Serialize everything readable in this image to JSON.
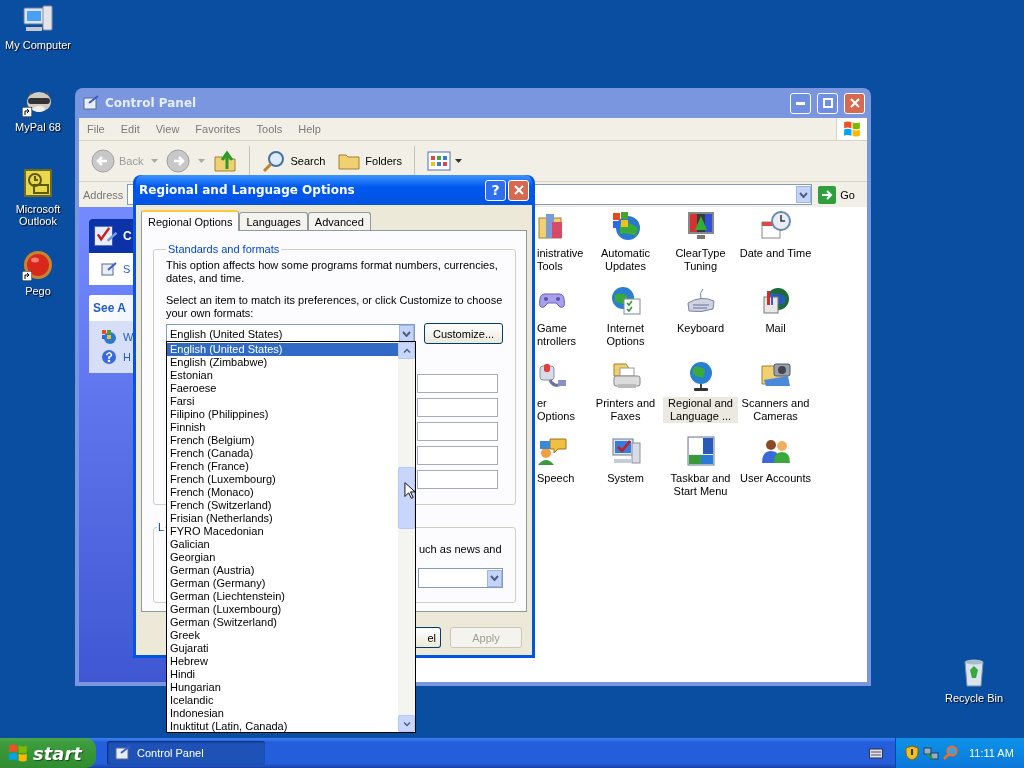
{
  "desktop_icons": [
    {
      "label": "My Computer",
      "kind": "computer",
      "shortcut": false
    },
    {
      "label": "MyPal 68",
      "kind": "raccoon",
      "shortcut": true
    },
    {
      "label": "Microsoft Outlook",
      "kind": "outlook",
      "shortcut": false
    },
    {
      "label": "Pego",
      "kind": "pego",
      "shortcut": true
    }
  ],
  "recycle_bin": {
    "label": "Recycle Bin"
  },
  "control_panel": {
    "title": "Control Panel",
    "menu": [
      "File",
      "Edit",
      "View",
      "Favorites",
      "Tools",
      "Help"
    ],
    "toolbar": {
      "back": "Back",
      "search": "Search",
      "folders": "Folders"
    },
    "address": {
      "label": "Address",
      "go": "Go"
    },
    "task_pane": [
      {
        "title": "C",
        "items": [
          "S"
        ]
      },
      {
        "title": "See A",
        "items": [
          "W",
          "H"
        ]
      }
    ],
    "items": [
      {
        "label": "inistrative Tools",
        "kind": "admin",
        "selected": false
      },
      {
        "label": "Automatic Updates",
        "kind": "updates",
        "selected": false
      },
      {
        "label": "ClearType Tuning",
        "kind": "cleartype",
        "selected": false
      },
      {
        "label": "Date and Time",
        "kind": "datetime",
        "selected": false
      },
      {
        "label": "Game ntrollers",
        "kind": "game",
        "selected": false
      },
      {
        "label": "Internet Options",
        "kind": "internet",
        "selected": false
      },
      {
        "label": "Keyboard",
        "kind": "keyboard",
        "selected": false
      },
      {
        "label": "Mail",
        "kind": "mail",
        "selected": false
      },
      {
        "label": "er Options",
        "kind": "power",
        "selected": false
      },
      {
        "label": "Printers and Faxes",
        "kind": "printer",
        "selected": false
      },
      {
        "label": "Regional and Language ...",
        "kind": "globe",
        "selected": true
      },
      {
        "label": "Scanners and Cameras",
        "kind": "scanner",
        "selected": false
      },
      {
        "label": "Speech",
        "kind": "speech",
        "selected": false
      },
      {
        "label": "System",
        "kind": "system",
        "selected": false
      },
      {
        "label": "Taskbar and Start Menu",
        "kind": "taskbar",
        "selected": false
      },
      {
        "label": "User Accounts",
        "kind": "users",
        "selected": false
      }
    ]
  },
  "dialog": {
    "title": "Regional and Language Options",
    "help_button": "?",
    "tabs": [
      {
        "label": "Regional Options",
        "selected": true
      },
      {
        "label": "Languages",
        "selected": false
      },
      {
        "label": "Advanced",
        "selected": false
      }
    ],
    "standards": {
      "label": "Standards and formats",
      "description": "This option affects how some programs format numbers, currencies, dates, and time.",
      "prompt": "Select an item to match its preferences, or click Customize to choose your own formats:",
      "format": "English (United States)",
      "customize": "Customize..."
    },
    "location": {
      "label": "L",
      "text": "uch as news and"
    },
    "buttons": [
      {
        "label": "el",
        "disabled": false
      },
      {
        "label": "Apply",
        "disabled": true
      }
    ]
  },
  "dropdown": {
    "items": [
      {
        "label": "English (United States)",
        "selected": true
      },
      {
        "label": "English (Zimbabwe)",
        "selected": false
      },
      {
        "label": "Estonian",
        "selected": false
      },
      {
        "label": "Faeroese",
        "selected": false
      },
      {
        "label": "Farsi",
        "selected": false
      },
      {
        "label": "Filipino (Philippines)",
        "selected": false
      },
      {
        "label": "Finnish",
        "selected": false
      },
      {
        "label": "French (Belgium)",
        "selected": false
      },
      {
        "label": "French (Canada)",
        "selected": false
      },
      {
        "label": "French (France)",
        "selected": false
      },
      {
        "label": "French (Luxembourg)",
        "selected": false
      },
      {
        "label": "French (Monaco)",
        "selected": false
      },
      {
        "label": "French (Switzerland)",
        "selected": false
      },
      {
        "label": "Frisian (Netherlands)",
        "selected": false
      },
      {
        "label": "FYRO Macedonian",
        "selected": false
      },
      {
        "label": "Galician",
        "selected": false
      },
      {
        "label": "Georgian",
        "selected": false
      },
      {
        "label": "German (Austria)",
        "selected": false
      },
      {
        "label": "German (Germany)",
        "selected": false
      },
      {
        "label": "German (Liechtenstein)",
        "selected": false
      },
      {
        "label": "German (Luxembourg)",
        "selected": false
      },
      {
        "label": "German (Switzerland)",
        "selected": false
      },
      {
        "label": "Greek",
        "selected": false
      },
      {
        "label": "Gujarati",
        "selected": false
      },
      {
        "label": "Hebrew",
        "selected": false
      },
      {
        "label": "Hindi",
        "selected": false
      },
      {
        "label": "Hungarian",
        "selected": false
      },
      {
        "label": "Icelandic",
        "selected": false
      },
      {
        "label": "Indonesian",
        "selected": false
      },
      {
        "label": "Inuktitut (Latin, Canada)",
        "selected": false
      }
    ]
  },
  "taskbar": {
    "start": "start",
    "tasks": [
      {
        "label": "Control Panel",
        "selected": true
      }
    ],
    "clock": "11:11 AM"
  }
}
